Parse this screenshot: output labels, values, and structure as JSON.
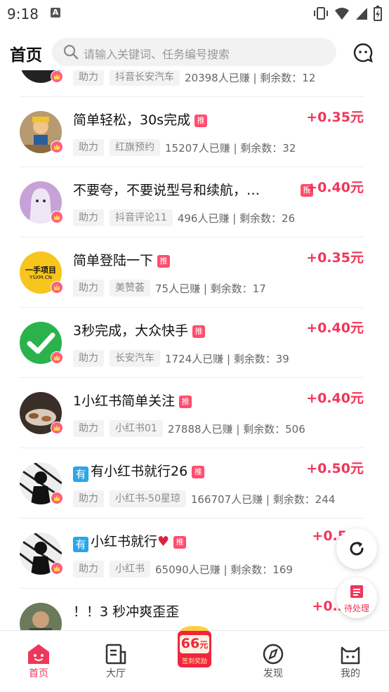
{
  "status_bar": {
    "time": "9:18"
  },
  "header": {
    "title": "首页",
    "search_placeholder": "请输入关键词、任务编号搜索"
  },
  "partial_item": {
    "tag1": "助力",
    "tag2": "抖音长安汽车",
    "stats": "20398人已赚 | 剩余数：12"
  },
  "items": [
    {
      "title": "简单轻松，30s完成",
      "reward": "+0.35元",
      "tag1": "助力",
      "tag2": "红旗预约",
      "stats": "15207人已赚 | 剩余数：32",
      "badge": "推"
    },
    {
      "title": "不要夸，不要说型号和续航，…",
      "reward": "+0.40元",
      "tag1": "助力",
      "tag2": "抖音评论11",
      "stats": "496人已赚 | 剩余数：26",
      "badge": "推"
    },
    {
      "title": "简单登陆一下",
      "reward": "+0.35元",
      "tag1": "助力",
      "tag2": "美赞荟",
      "stats": "75人已赚 | 剩余数：17",
      "badge": "推",
      "avatar_text": "一手项目",
      "avatar_sub": "YSXM.CN"
    },
    {
      "title": "3秒完成，大众快手",
      "reward": "+0.40元",
      "tag1": "助力",
      "tag2": "长安汽车",
      "stats": "1724人已赚 | 剩余数：39",
      "badge": "推"
    },
    {
      "title": "1小红书简单关注",
      "reward": "+0.40元",
      "tag1": "助力",
      "tag2": "小红书01",
      "stats": "27888人已赚 | 剩余数：506",
      "badge": "推"
    },
    {
      "title": "有小红书就行26",
      "prefix": "有",
      "reward": "+0.50元",
      "tag1": "助力",
      "tag2": "小红书-50星琼",
      "stats": "166707人已赚 | 剩余数：244",
      "badge": "推"
    },
    {
      "title": "小红书就行",
      "prefix": "有",
      "heart": "♥",
      "reward": "+0.5",
      "tag1": "助力",
      "tag2": "小红书",
      "stats": "65090人已赚 | 剩余数：169",
      "badge": "推"
    },
    {
      "title": "！！3 秒冲爽歪歪",
      "reward": "+0.3"
    }
  ],
  "fab": {
    "pending_label": "待处理"
  },
  "tabbar": {
    "tabs": [
      {
        "label": "首页"
      },
      {
        "label": "大厅"
      },
      {
        "label": "发现"
      },
      {
        "label": "我的"
      }
    ],
    "center_badge_amount": "66",
    "center_badge_unit": "元",
    "center_badge_label": "签到奖励"
  },
  "colors": {
    "accent": "#f0365a"
  }
}
